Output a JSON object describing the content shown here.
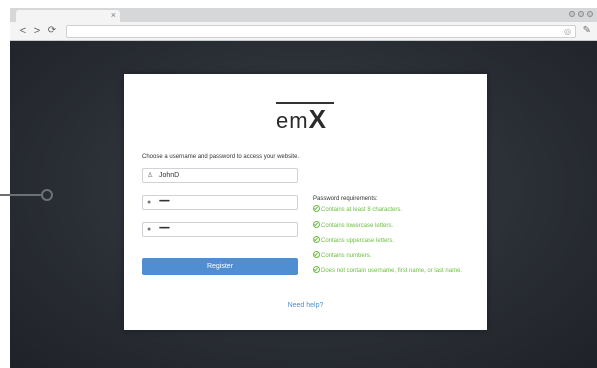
{
  "browser": {
    "tab_close": "×",
    "nav_back": "<",
    "nav_forward": ">",
    "nav_reload": "⟳"
  },
  "logo": {
    "prefix": "em",
    "suffix": "X"
  },
  "form": {
    "instruction": "Choose a username and password to access your website.",
    "username_value": "JohnD",
    "password_value": "•••••••••",
    "confirm_value": "•••••••••",
    "register_label": "Register"
  },
  "requirements": {
    "title": "Password requirements:",
    "items": [
      "Contains at least 8 characters.",
      "Contains lowercase letters.",
      "Contains uppercase letters.",
      "Contains numbers.",
      "Does not contain username, first name, or last name."
    ]
  },
  "help_link": "Need help?",
  "colors": {
    "accent": "#4f8ed0",
    "success": "#6cbf3f",
    "background": "#2a2e35"
  }
}
